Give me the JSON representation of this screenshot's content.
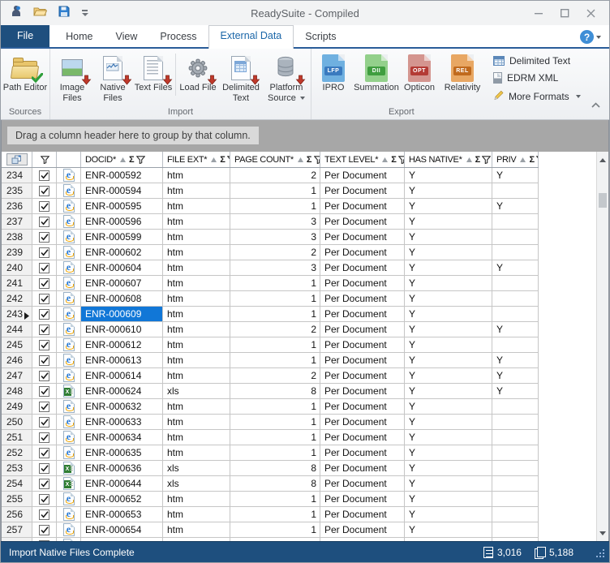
{
  "window": {
    "title": "ReadySuite - Compiled"
  },
  "tabs": {
    "items": [
      {
        "label": "File"
      },
      {
        "label": "Home"
      },
      {
        "label": "View"
      },
      {
        "label": "Process"
      },
      {
        "label": "External Data",
        "active": true
      },
      {
        "label": "Scripts"
      }
    ],
    "help_label": "?"
  },
  "ribbon": {
    "groups": [
      {
        "label": "Sources",
        "buttons": [
          {
            "label": "Path Editor"
          }
        ]
      },
      {
        "label": "Import",
        "buttons": [
          {
            "label": "Image Files"
          },
          {
            "label": "Native Files"
          },
          {
            "label": "Text Files"
          },
          {
            "label": "Load File"
          },
          {
            "label": "Delimited Text"
          },
          {
            "label": "Platform Source",
            "dropdown": true
          }
        ]
      },
      {
        "label": "Export",
        "buttons": [
          {
            "label": "IPRO",
            "badge": "LFP",
            "file_color": "#6fb0e0",
            "badge_color": "#3a7abf"
          },
          {
            "label": "Summation",
            "badge": "DII",
            "file_color": "#93d08b",
            "badge_color": "#3f9e3f"
          },
          {
            "label": "Opticon",
            "badge": "OPT",
            "file_color": "#d4958f",
            "badge_color": "#b43b35"
          },
          {
            "label": "Relativity",
            "badge": "REL",
            "file_color": "#e8a763",
            "badge_color": "#c06a1d"
          }
        ],
        "small_buttons": [
          {
            "label": "Delimited Text"
          },
          {
            "label": "EDRM XML"
          },
          {
            "label": "More Formats",
            "dropdown": true
          }
        ]
      }
    ]
  },
  "grid": {
    "group_hint": "Drag a column header here to group by that column.",
    "columns": [
      {
        "label": "DOCID*",
        "sorted": true
      },
      {
        "label": "FILE EXT*"
      },
      {
        "label": "PAGE COUNT*"
      },
      {
        "label": "TEXT LEVEL*"
      },
      {
        "label": "HAS NATIVE*"
      },
      {
        "label": "PRIV"
      }
    ],
    "rows": [
      {
        "num": "234",
        "checked": true,
        "docid": "ENR-000592",
        "ext": "htm",
        "pages": "2",
        "text_level": "Per Document",
        "has_native": "Y",
        "priv": "Y"
      },
      {
        "num": "235",
        "checked": true,
        "docid": "ENR-000594",
        "ext": "htm",
        "pages": "1",
        "text_level": "Per Document",
        "has_native": "Y",
        "priv": ""
      },
      {
        "num": "236",
        "checked": true,
        "docid": "ENR-000595",
        "ext": "htm",
        "pages": "1",
        "text_level": "Per Document",
        "has_native": "Y",
        "priv": "Y"
      },
      {
        "num": "237",
        "checked": true,
        "docid": "ENR-000596",
        "ext": "htm",
        "pages": "3",
        "text_level": "Per Document",
        "has_native": "Y",
        "priv": ""
      },
      {
        "num": "238",
        "checked": true,
        "docid": "ENR-000599",
        "ext": "htm",
        "pages": "3",
        "text_level": "Per Document",
        "has_native": "Y",
        "priv": ""
      },
      {
        "num": "239",
        "checked": true,
        "docid": "ENR-000602",
        "ext": "htm",
        "pages": "2",
        "text_level": "Per Document",
        "has_native": "Y",
        "priv": ""
      },
      {
        "num": "240",
        "checked": true,
        "docid": "ENR-000604",
        "ext": "htm",
        "pages": "3",
        "text_level": "Per Document",
        "has_native": "Y",
        "priv": "Y"
      },
      {
        "num": "241",
        "checked": true,
        "docid": "ENR-000607",
        "ext": "htm",
        "pages": "1",
        "text_level": "Per Document",
        "has_native": "Y",
        "priv": ""
      },
      {
        "num": "242",
        "checked": true,
        "docid": "ENR-000608",
        "ext": "htm",
        "pages": "1",
        "text_level": "Per Document",
        "has_native": "Y",
        "priv": ""
      },
      {
        "num": "243",
        "checked": true,
        "docid": "ENR-000609",
        "ext": "htm",
        "pages": "1",
        "text_level": "Per Document",
        "has_native": "Y",
        "priv": "",
        "selected": true
      },
      {
        "num": "244",
        "checked": true,
        "docid": "ENR-000610",
        "ext": "htm",
        "pages": "2",
        "text_level": "Per Document",
        "has_native": "Y",
        "priv": "Y"
      },
      {
        "num": "245",
        "checked": true,
        "docid": "ENR-000612",
        "ext": "htm",
        "pages": "1",
        "text_level": "Per Document",
        "has_native": "Y",
        "priv": ""
      },
      {
        "num": "246",
        "checked": true,
        "docid": "ENR-000613",
        "ext": "htm",
        "pages": "1",
        "text_level": "Per Document",
        "has_native": "Y",
        "priv": "Y"
      },
      {
        "num": "247",
        "checked": true,
        "docid": "ENR-000614",
        "ext": "htm",
        "pages": "2",
        "text_level": "Per Document",
        "has_native": "Y",
        "priv": "Y"
      },
      {
        "num": "248",
        "checked": true,
        "docid": "ENR-000624",
        "ext": "xls",
        "pages": "8",
        "text_level": "Per Document",
        "has_native": "Y",
        "priv": "Y"
      },
      {
        "num": "249",
        "checked": true,
        "docid": "ENR-000632",
        "ext": "htm",
        "pages": "1",
        "text_level": "Per Document",
        "has_native": "Y",
        "priv": ""
      },
      {
        "num": "250",
        "checked": true,
        "docid": "ENR-000633",
        "ext": "htm",
        "pages": "1",
        "text_level": "Per Document",
        "has_native": "Y",
        "priv": ""
      },
      {
        "num": "251",
        "checked": true,
        "docid": "ENR-000634",
        "ext": "htm",
        "pages": "1",
        "text_level": "Per Document",
        "has_native": "Y",
        "priv": ""
      },
      {
        "num": "252",
        "checked": true,
        "docid": "ENR-000635",
        "ext": "htm",
        "pages": "1",
        "text_level": "Per Document",
        "has_native": "Y",
        "priv": ""
      },
      {
        "num": "253",
        "checked": true,
        "docid": "ENR-000636",
        "ext": "xls",
        "pages": "8",
        "text_level": "Per Document",
        "has_native": "Y",
        "priv": ""
      },
      {
        "num": "254",
        "checked": true,
        "docid": "ENR-000644",
        "ext": "xls",
        "pages": "8",
        "text_level": "Per Document",
        "has_native": "Y",
        "priv": ""
      },
      {
        "num": "255",
        "checked": true,
        "docid": "ENR-000652",
        "ext": "htm",
        "pages": "1",
        "text_level": "Per Document",
        "has_native": "Y",
        "priv": ""
      },
      {
        "num": "256",
        "checked": true,
        "docid": "ENR-000653",
        "ext": "htm",
        "pages": "1",
        "text_level": "Per Document",
        "has_native": "Y",
        "priv": ""
      },
      {
        "num": "257",
        "checked": true,
        "docid": "ENR-000654",
        "ext": "htm",
        "pages": "1",
        "text_level": "Per Document",
        "has_native": "Y",
        "priv": ""
      }
    ]
  },
  "status_bar": {
    "message": "Import Native Files Complete",
    "document_count": "3,016",
    "page_count": "5,188"
  },
  "colors": {
    "accent_dark_blue": "#1e4f7e",
    "selection_blue": "#1177d7",
    "active_tab_text": "#1a66a8"
  }
}
